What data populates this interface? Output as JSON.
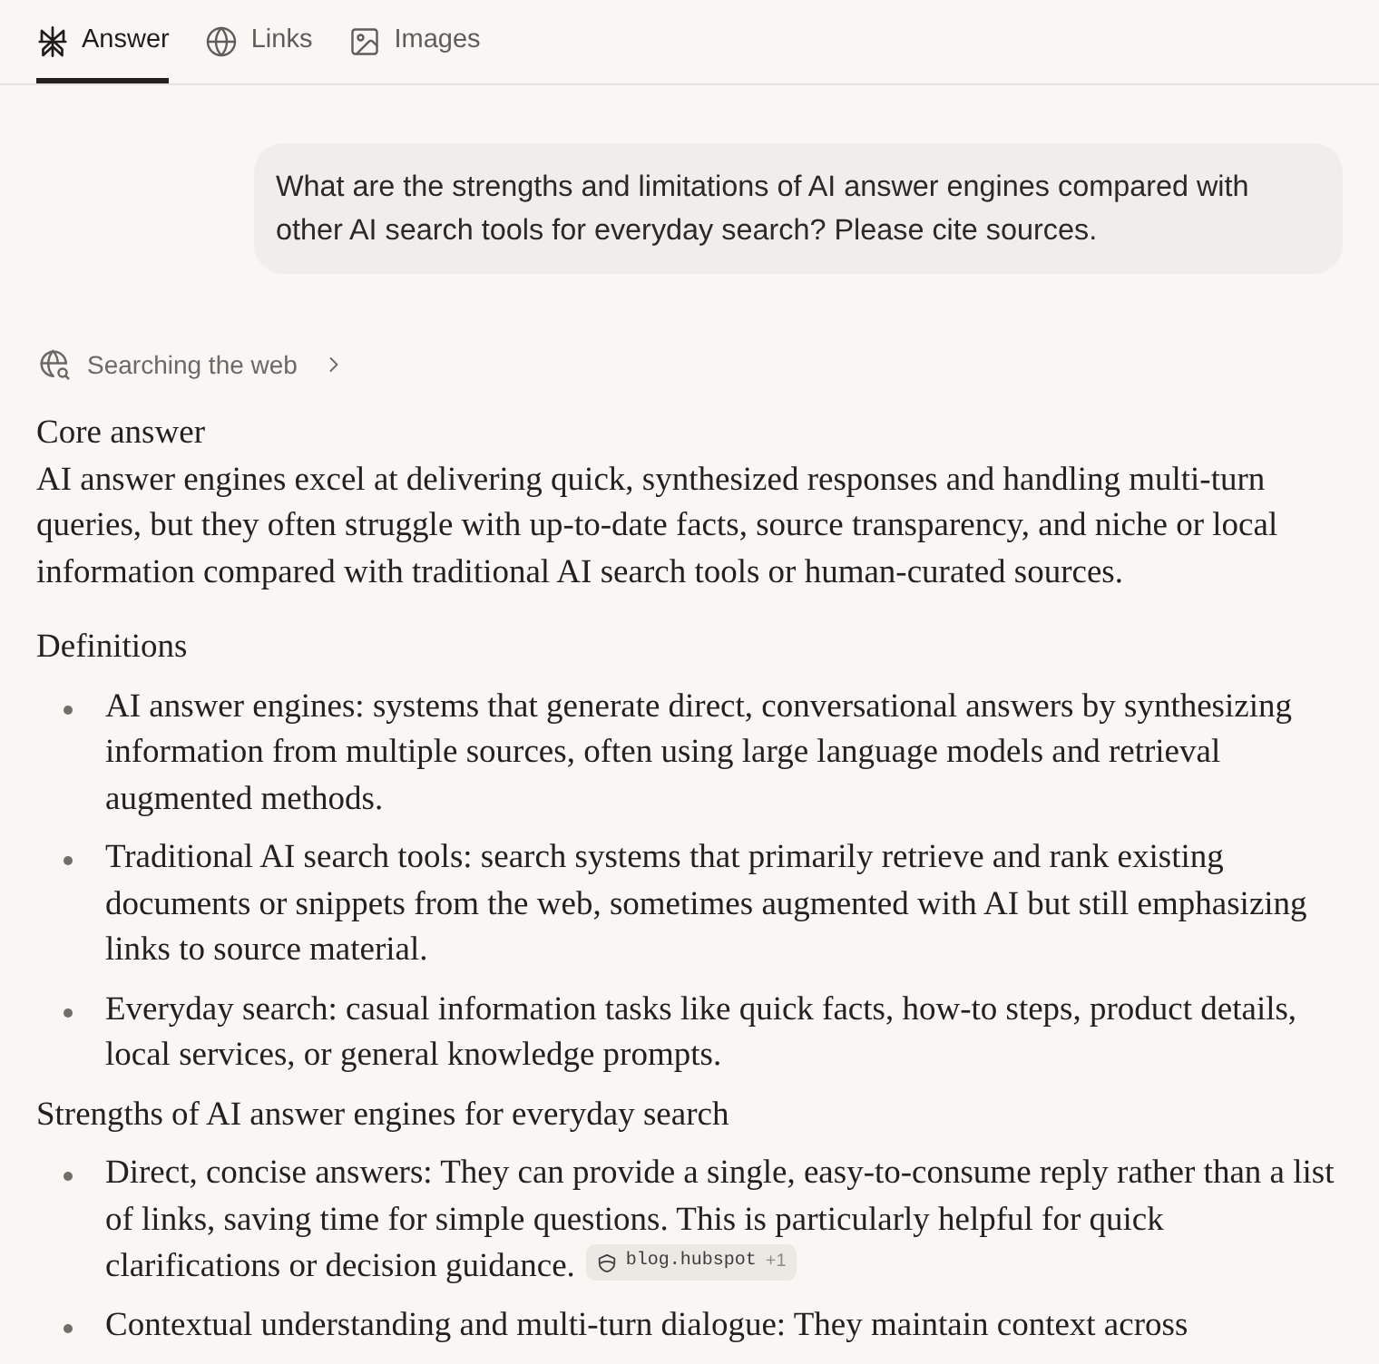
{
  "tabs": [
    {
      "label": "Answer",
      "selected": true
    },
    {
      "label": "Links",
      "selected": false
    },
    {
      "label": "Images",
      "selected": false
    }
  ],
  "query": {
    "text": "What are the strengths and limitations of AI answer engines compared with other AI search tools for everyday search? Please cite sources."
  },
  "status": {
    "label": "Searching the web"
  },
  "answer": {
    "sections": [
      {
        "heading": "Core answer",
        "paragraphs": [
          "AI answer engines excel at delivering quick, synthesized responses and handling multi-turn queries, but they often struggle with up-to-date facts, source transparency, and niche or local information compared with traditional AI search tools or human-curated sources."
        ]
      },
      {
        "heading": "Definitions",
        "bullets": [
          {
            "text": "AI answer engines: systems that generate direct, conversational answers by synthesizing information from multiple sources, often using large language models and retrieval augmented methods."
          },
          {
            "text": "Traditional AI search tools: search systems that primarily retrieve and rank existing documents or snippets from the web, sometimes augmented with AI but still emphasizing links to source material."
          },
          {
            "text": "Everyday search: casual information tasks like quick facts, how-to steps, product details, local services, or general knowledge prompts."
          }
        ]
      },
      {
        "heading": "Strengths of AI answer engines for everyday search",
        "bullets": [
          {
            "text": "Direct, concise answers: They can provide a single, easy-to-consume reply rather than a list of links, saving time for simple questions. This is particularly helpful for quick clarifications or decision guidance.",
            "citation": {
              "source": "blog.hubspot",
              "more": "+1"
            }
          },
          {
            "text": "Contextual understanding and multi-turn dialogue: They maintain context across"
          }
        ]
      }
    ]
  }
}
